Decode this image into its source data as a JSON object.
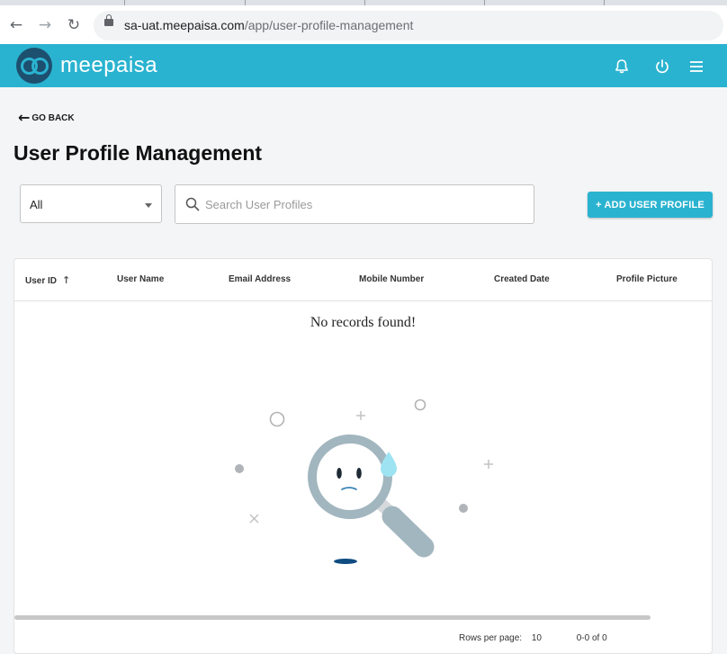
{
  "browser": {
    "url_host": "sa-uat.meepaisa.com",
    "url_path": "/app/user-profile-management"
  },
  "header": {
    "brand": "meepaisa",
    "icons": [
      "bell-icon",
      "power-icon",
      "menu-icon"
    ]
  },
  "page": {
    "go_back": "GO BACK",
    "title": "User Profile Management"
  },
  "filter": {
    "selected": "All"
  },
  "search": {
    "placeholder": "Search User Profiles",
    "value": ""
  },
  "actions": {
    "add_label": "+ ADD USER PROFILE"
  },
  "table": {
    "columns": [
      "User ID",
      "User Name",
      "Email Address",
      "Mobile Number",
      "Created Date",
      "Profile Picture"
    ],
    "sorted_column": "User ID",
    "sort_direction": "ascending",
    "empty_message": "No records found!",
    "rows": []
  },
  "pagination": {
    "rows_per_page_label": "Rows per page:",
    "rows_per_page": "10",
    "range": "0-0 of 0"
  },
  "colors": {
    "accent": "#2ab3d0",
    "logo_dark": "#1d4f6e",
    "background": "#f4f5f7"
  }
}
